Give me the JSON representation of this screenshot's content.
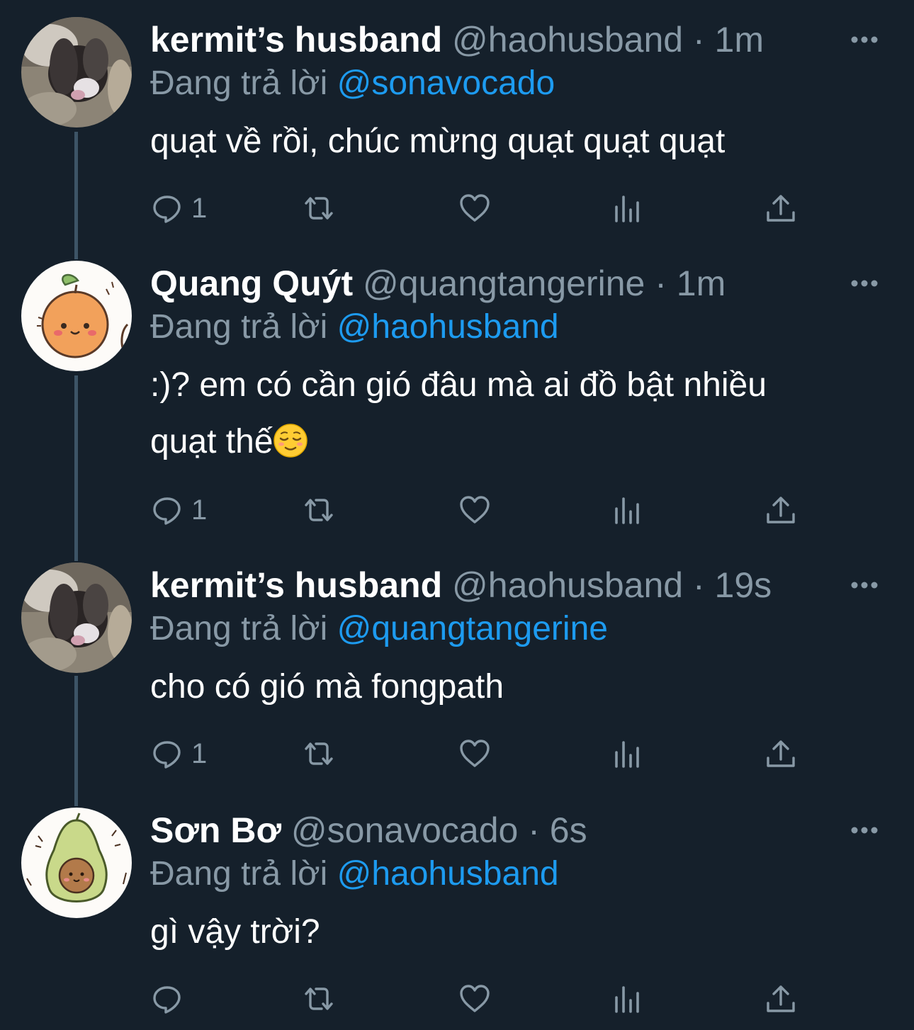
{
  "colors": {
    "background": "#15202b",
    "secondary_text": "#8899a6",
    "mention": "#1d9bf0",
    "thread_line": "#3d5466"
  },
  "tweets": [
    {
      "display_name": "kermit’s husband",
      "handle": "@haohusband",
      "separator": "·",
      "time": "1m",
      "reply_prefix": "Đang trả lời",
      "reply_to": "@sonavocado",
      "text_lines": [
        "quạt về rồi, chúc mừng quạt quạt quạt"
      ],
      "reply_count": "1",
      "avatar_icon": "cat-photo-avatar"
    },
    {
      "display_name": "Quang Quýt",
      "handle": "@quangtangerine",
      "separator": "·",
      "time": "1m",
      "reply_prefix": "Đang trả lời",
      "reply_to": "@haohusband",
      "text_lines": [
        ":)? em có cần gió đâu mà ai đồ bật nhiều",
        "quạt thế"
      ],
      "emoji": "relieved-face-emoji",
      "reply_count": "1",
      "avatar_icon": "tangerine-avatar"
    },
    {
      "display_name": "kermit’s husband",
      "handle": "@haohusband",
      "separator": "·",
      "time": "19s",
      "reply_prefix": "Đang trả lời",
      "reply_to": "@quangtangerine",
      "text_lines": [
        "cho có gió mà fongpath"
      ],
      "reply_count": "1",
      "avatar_icon": "cat-photo-avatar"
    },
    {
      "display_name": "Sơn Bơ",
      "handle": "@sonavocado",
      "separator": "·",
      "time": "6s",
      "reply_prefix": "Đang trả lời",
      "reply_to": "@haohusband",
      "text_lines": [
        "gì vậy trời?"
      ],
      "reply_count": "",
      "avatar_icon": "avocado-avatar"
    }
  ]
}
